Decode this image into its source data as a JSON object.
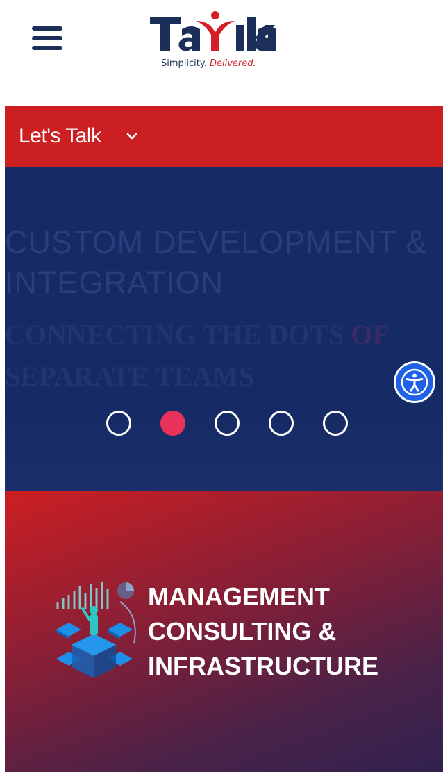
{
  "header": {
    "menu_icon": "hamburger-menu-icon",
    "logo": {
      "wordmark": "TaYika",
      "tagline_part1": "Simplicity.",
      "tagline_part2": "Delivered."
    }
  },
  "talk_bar": {
    "label": "Let's Talk",
    "icon": "chevron-down-icon"
  },
  "hero": {
    "title_line1": "CUSTOM DEVELOPMENT &",
    "title_line2": "INTEGRATION",
    "subtitle_line1_main": "CONNECTING THE DOTS",
    "subtitle_line1_dim": "OF",
    "subtitle_line2": "SEPARATE TEAMS",
    "slides_total": 5,
    "active_slide": 2
  },
  "accessibility": {
    "icon": "accessibility-person-icon"
  },
  "service_card": {
    "title_line1": "MANAGEMENT",
    "title_line2": "CONSULTING &",
    "title_line3": "INFRASTRUCTURE",
    "icon": "isometric-analytics-icon"
  },
  "colors": {
    "brand_navy": "#1b2f5a",
    "brand_red": "#cc1f22",
    "hero_bg": "#162a66",
    "dot_active": "#e8325a",
    "accessibility_blue": "#1f62e8"
  }
}
